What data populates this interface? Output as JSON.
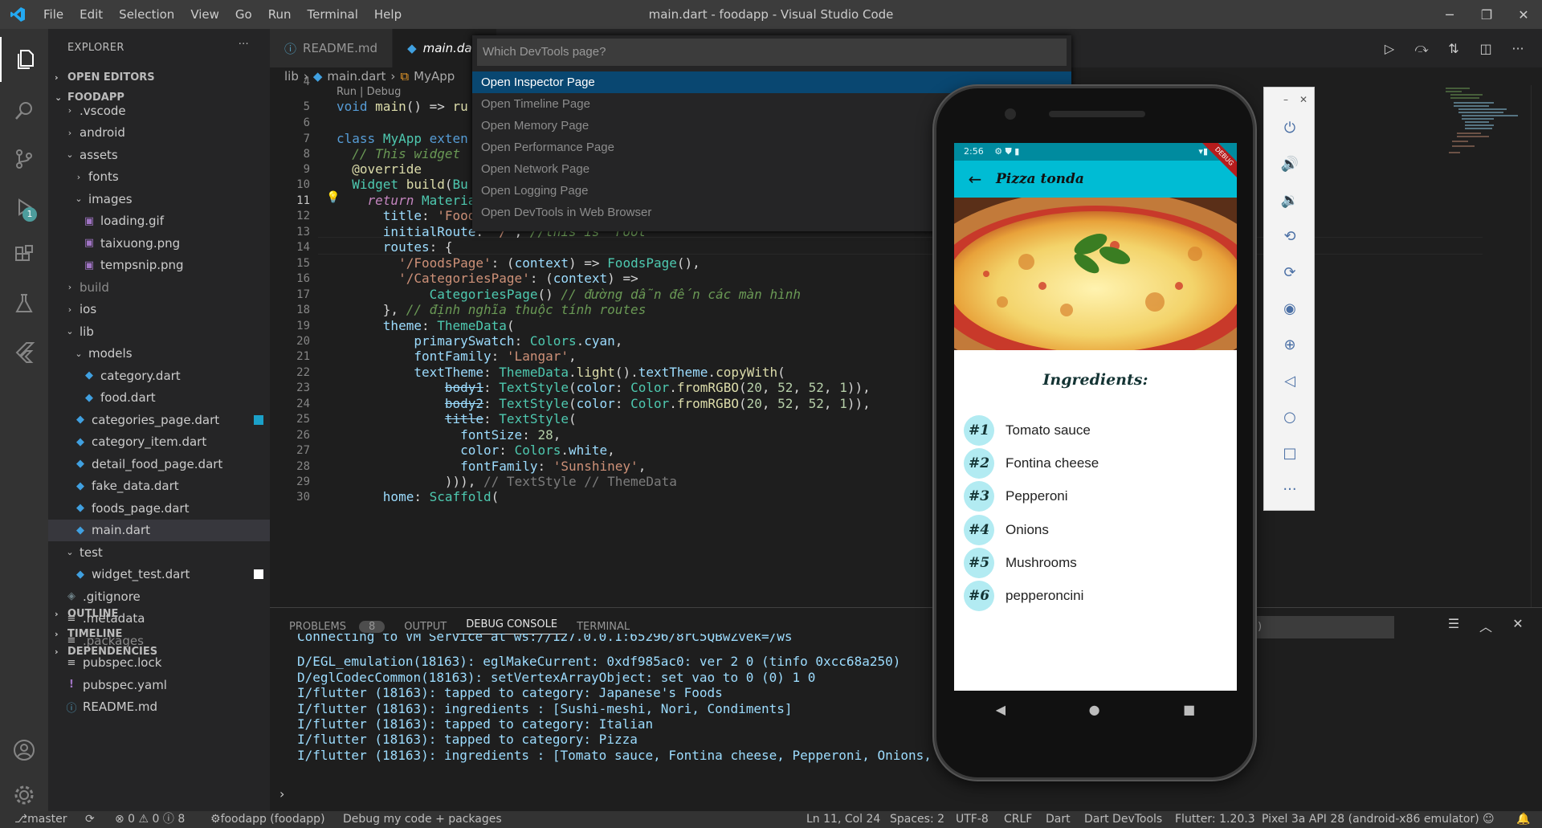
{
  "titlebar": {
    "menu": [
      "File",
      "Edit",
      "Selection",
      "View",
      "Go",
      "Run",
      "Terminal",
      "Help"
    ],
    "title": "main.dart - foodapp - Visual Studio Code"
  },
  "activitybar": {
    "run_badge": "1"
  },
  "sidebar": {
    "header": "EXPLORER",
    "open_editors": "OPEN EDITORS",
    "project": "FOODAPP",
    "tree": [
      {
        "label": ".vscode",
        "indent": 1,
        "chev": "›",
        "icon": ""
      },
      {
        "label": "android",
        "indent": 1,
        "chev": "›",
        "icon": ""
      },
      {
        "label": "assets",
        "indent": 1,
        "chev": "⌄",
        "icon": ""
      },
      {
        "label": "fonts",
        "indent": 2,
        "chev": "›",
        "icon": ""
      },
      {
        "label": "images",
        "indent": 2,
        "chev": "⌄",
        "icon": ""
      },
      {
        "label": "loading.gif",
        "indent": 3,
        "chev": "",
        "icon": "img"
      },
      {
        "label": "taixuong.png",
        "indent": 3,
        "chev": "",
        "icon": "img"
      },
      {
        "label": "tempsnip.png",
        "indent": 3,
        "chev": "",
        "icon": "img"
      },
      {
        "label": "build",
        "indent": 1,
        "chev": "›",
        "icon": "",
        "dim": true
      },
      {
        "label": "ios",
        "indent": 1,
        "chev": "›",
        "icon": ""
      },
      {
        "label": "lib",
        "indent": 1,
        "chev": "⌄",
        "icon": ""
      },
      {
        "label": "models",
        "indent": 2,
        "chev": "⌄",
        "icon": ""
      },
      {
        "label": "category.dart",
        "indent": 3,
        "chev": "",
        "icon": "dart"
      },
      {
        "label": "food.dart",
        "indent": 3,
        "chev": "",
        "icon": "dart"
      },
      {
        "label": "categories_page.dart",
        "indent": 2,
        "chev": "",
        "icon": "dart",
        "mark": "blue"
      },
      {
        "label": "category_item.dart",
        "indent": 2,
        "chev": "",
        "icon": "dart"
      },
      {
        "label": "detail_food_page.dart",
        "indent": 2,
        "chev": "",
        "icon": "dart"
      },
      {
        "label": "fake_data.dart",
        "indent": 2,
        "chev": "",
        "icon": "dart"
      },
      {
        "label": "foods_page.dart",
        "indent": 2,
        "chev": "",
        "icon": "dart"
      },
      {
        "label": "main.dart",
        "indent": 2,
        "chev": "",
        "icon": "dart",
        "selected": true
      },
      {
        "label": "test",
        "indent": 1,
        "chev": "⌄",
        "icon": ""
      },
      {
        "label": "widget_test.dart",
        "indent": 2,
        "chev": "",
        "icon": "dart",
        "mark": "white"
      },
      {
        "label": ".gitignore",
        "indent": 1,
        "chev": "",
        "icon": "git"
      },
      {
        "label": ".metadata",
        "indent": 1,
        "chev": "",
        "icon": "lines"
      },
      {
        "label": ".packages",
        "indent": 1,
        "chev": "",
        "icon": "lines",
        "dim": true
      },
      {
        "label": "pubspec.lock",
        "indent": 1,
        "chev": "",
        "icon": "lines"
      },
      {
        "label": "pubspec.yaml",
        "indent": 1,
        "chev": "",
        "icon": "yaml"
      },
      {
        "label": "README.md",
        "indent": 1,
        "chev": "",
        "icon": "info"
      }
    ],
    "outline": "OUTLINE",
    "timeline": "TIMELINE",
    "dependencies": "DEPENDENCIES"
  },
  "tabs": [
    {
      "label": "README.md",
      "active": false
    },
    {
      "label": "main.dart",
      "active": true
    }
  ],
  "breadcrumb": [
    "lib",
    "›",
    "main.dart",
    "›",
    "MyApp"
  ],
  "editor": {
    "codelens": "Run | Debug",
    "line_numbers": [
      "4",
      "5",
      "6",
      "7",
      "8",
      "9",
      "10",
      "11",
      "12",
      "13",
      "14",
      "15",
      "16",
      "17",
      "18",
      "19",
      "20",
      "21",
      "22",
      "23",
      "24",
      "25",
      "26",
      "27",
      "28",
      "29",
      "30"
    ],
    "current_line": "11"
  },
  "quickpick": {
    "placeholder": "Which DevTools page?",
    "items": [
      "Open Inspector Page",
      "Open Timeline Page",
      "Open Memory Page",
      "Open Performance Page",
      "Open Network Page",
      "Open Logging Page",
      "Open DevTools in Web Browser"
    ],
    "selected": "Open Inspector Page"
  },
  "panel": {
    "tabs": [
      "PROBLEMS",
      "OUTPUT",
      "DEBUG CONSOLE",
      "TERMINAL"
    ],
    "problems_count": "8",
    "active": "DEBUG CONSOLE",
    "console": [
      "Connecting to VM Service at ws://127.0.0.1:65296/8rC5QBwZvek=/ws",
      "D/EGL_emulation(18163): eglMakeCurrent: 0xdf985ac0: ver 2 0 (tinfo 0xcc68a250)",
      "D/eglCodecCommon(18163): setVertexArrayObject: set vao to 0 (0) 1 0",
      "I/flutter (18163): tapped to category: Japanese's Foods",
      "I/flutter (18163): ingredients : [Sushi-meshi, Nori, Condiments]",
      "I/flutter (18163): tapped to category: Italian",
      "I/flutter (18163): tapped to category: Pizza",
      "I/flutter (18163): ingredients : [Tomato sauce, Fontina cheese, Pepperoni, Onions, Mushrooms, pepperoncini]"
    ],
    "prompt": "›"
  },
  "statusbar": {
    "branch": "master",
    "problems": "⊗ 0 ⚠ 0 ⓘ 8",
    "project": "foodapp (foodapp)",
    "debug_mode": "Debug my code + packages",
    "position": "Ln 11, Col 24",
    "spaces": "Spaces: 2",
    "encoding": "UTF-8",
    "eol": "CRLF",
    "language": "Dart",
    "devtools": "Dart DevTools",
    "flutter": "Flutter: 1.20.3",
    "device": "Pixel 3a API 28 (android-x86 emulator)"
  },
  "phone": {
    "time": "2:56",
    "debug_banner": "DEBUG",
    "app_title": "Pizza tonda",
    "ingredients_title": "Ingredients:",
    "ingredients": [
      {
        "num": "#1",
        "name": "Tomato sauce"
      },
      {
        "num": "#2",
        "name": "Fontina cheese"
      },
      {
        "num": "#3",
        "name": "Pepperoni"
      },
      {
        "num": "#4",
        "name": "Onions"
      },
      {
        "num": "#5",
        "name": "Mushrooms"
      },
      {
        "num": "#6",
        "name": "pepperoncini"
      }
    ]
  },
  "colors": {
    "accent": "#007acc",
    "appbar": "#00bcd4",
    "circle": "#b2ebf2",
    "selection": "#094771"
  }
}
